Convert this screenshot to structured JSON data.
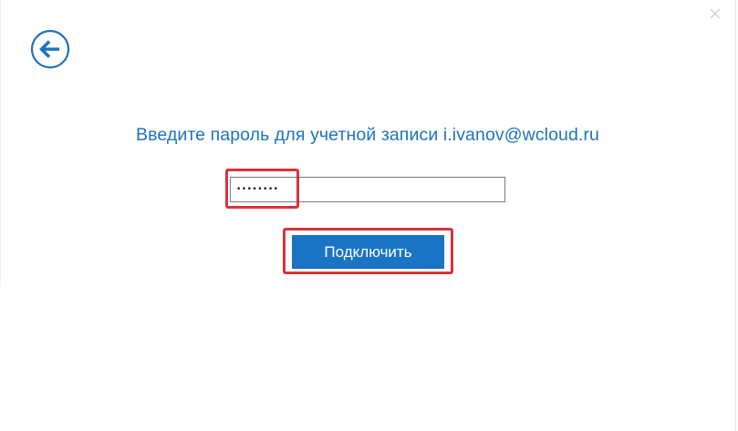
{
  "dialog": {
    "back_icon": "arrow-left-circle-icon",
    "close_icon": "close-x-icon",
    "prompt_text": "Введите пароль для учетной записи i.ivanov@wcloud.ru",
    "password_value": "••••••••",
    "connect_label": "Подключить"
  },
  "colors": {
    "accent": "#1e73be",
    "button_bg": "#1a73c5",
    "highlight": "#d9333b"
  }
}
